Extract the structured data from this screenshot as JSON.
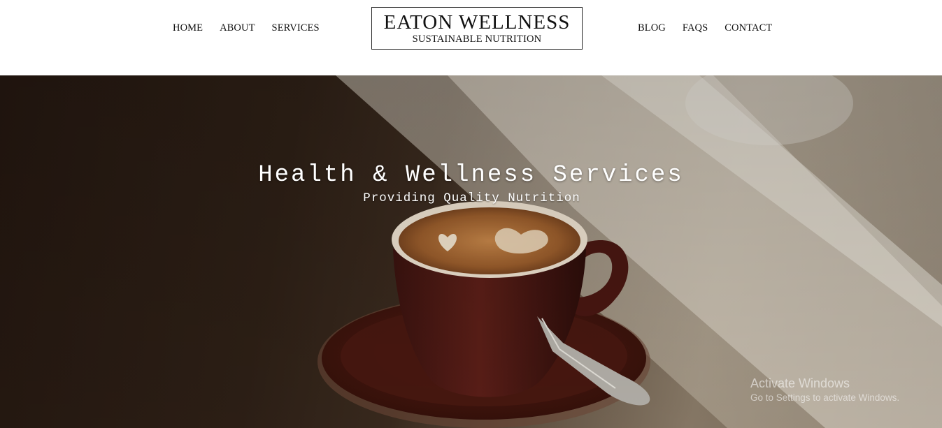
{
  "nav": {
    "left": [
      "HOME",
      "ABOUT",
      "SERVICES"
    ],
    "right": [
      "BLOG",
      "FAQS",
      "CONTACT"
    ]
  },
  "logo": {
    "title": "EATON WELLNESS",
    "subtitle": "SUSTAINABLE NUTRITION"
  },
  "hero": {
    "title": "Health & Wellness Services",
    "subtitle": "Providing Quality Nutrition",
    "image": "coffee-cup-latte-art-photo"
  },
  "watermark": {
    "title": "Activate Windows",
    "subtitle": "Go to Settings to activate Windows."
  },
  "colors": {
    "header_bg": "#ffffff",
    "nav_text": "#111111",
    "hero_text": "#ffffff"
  }
}
